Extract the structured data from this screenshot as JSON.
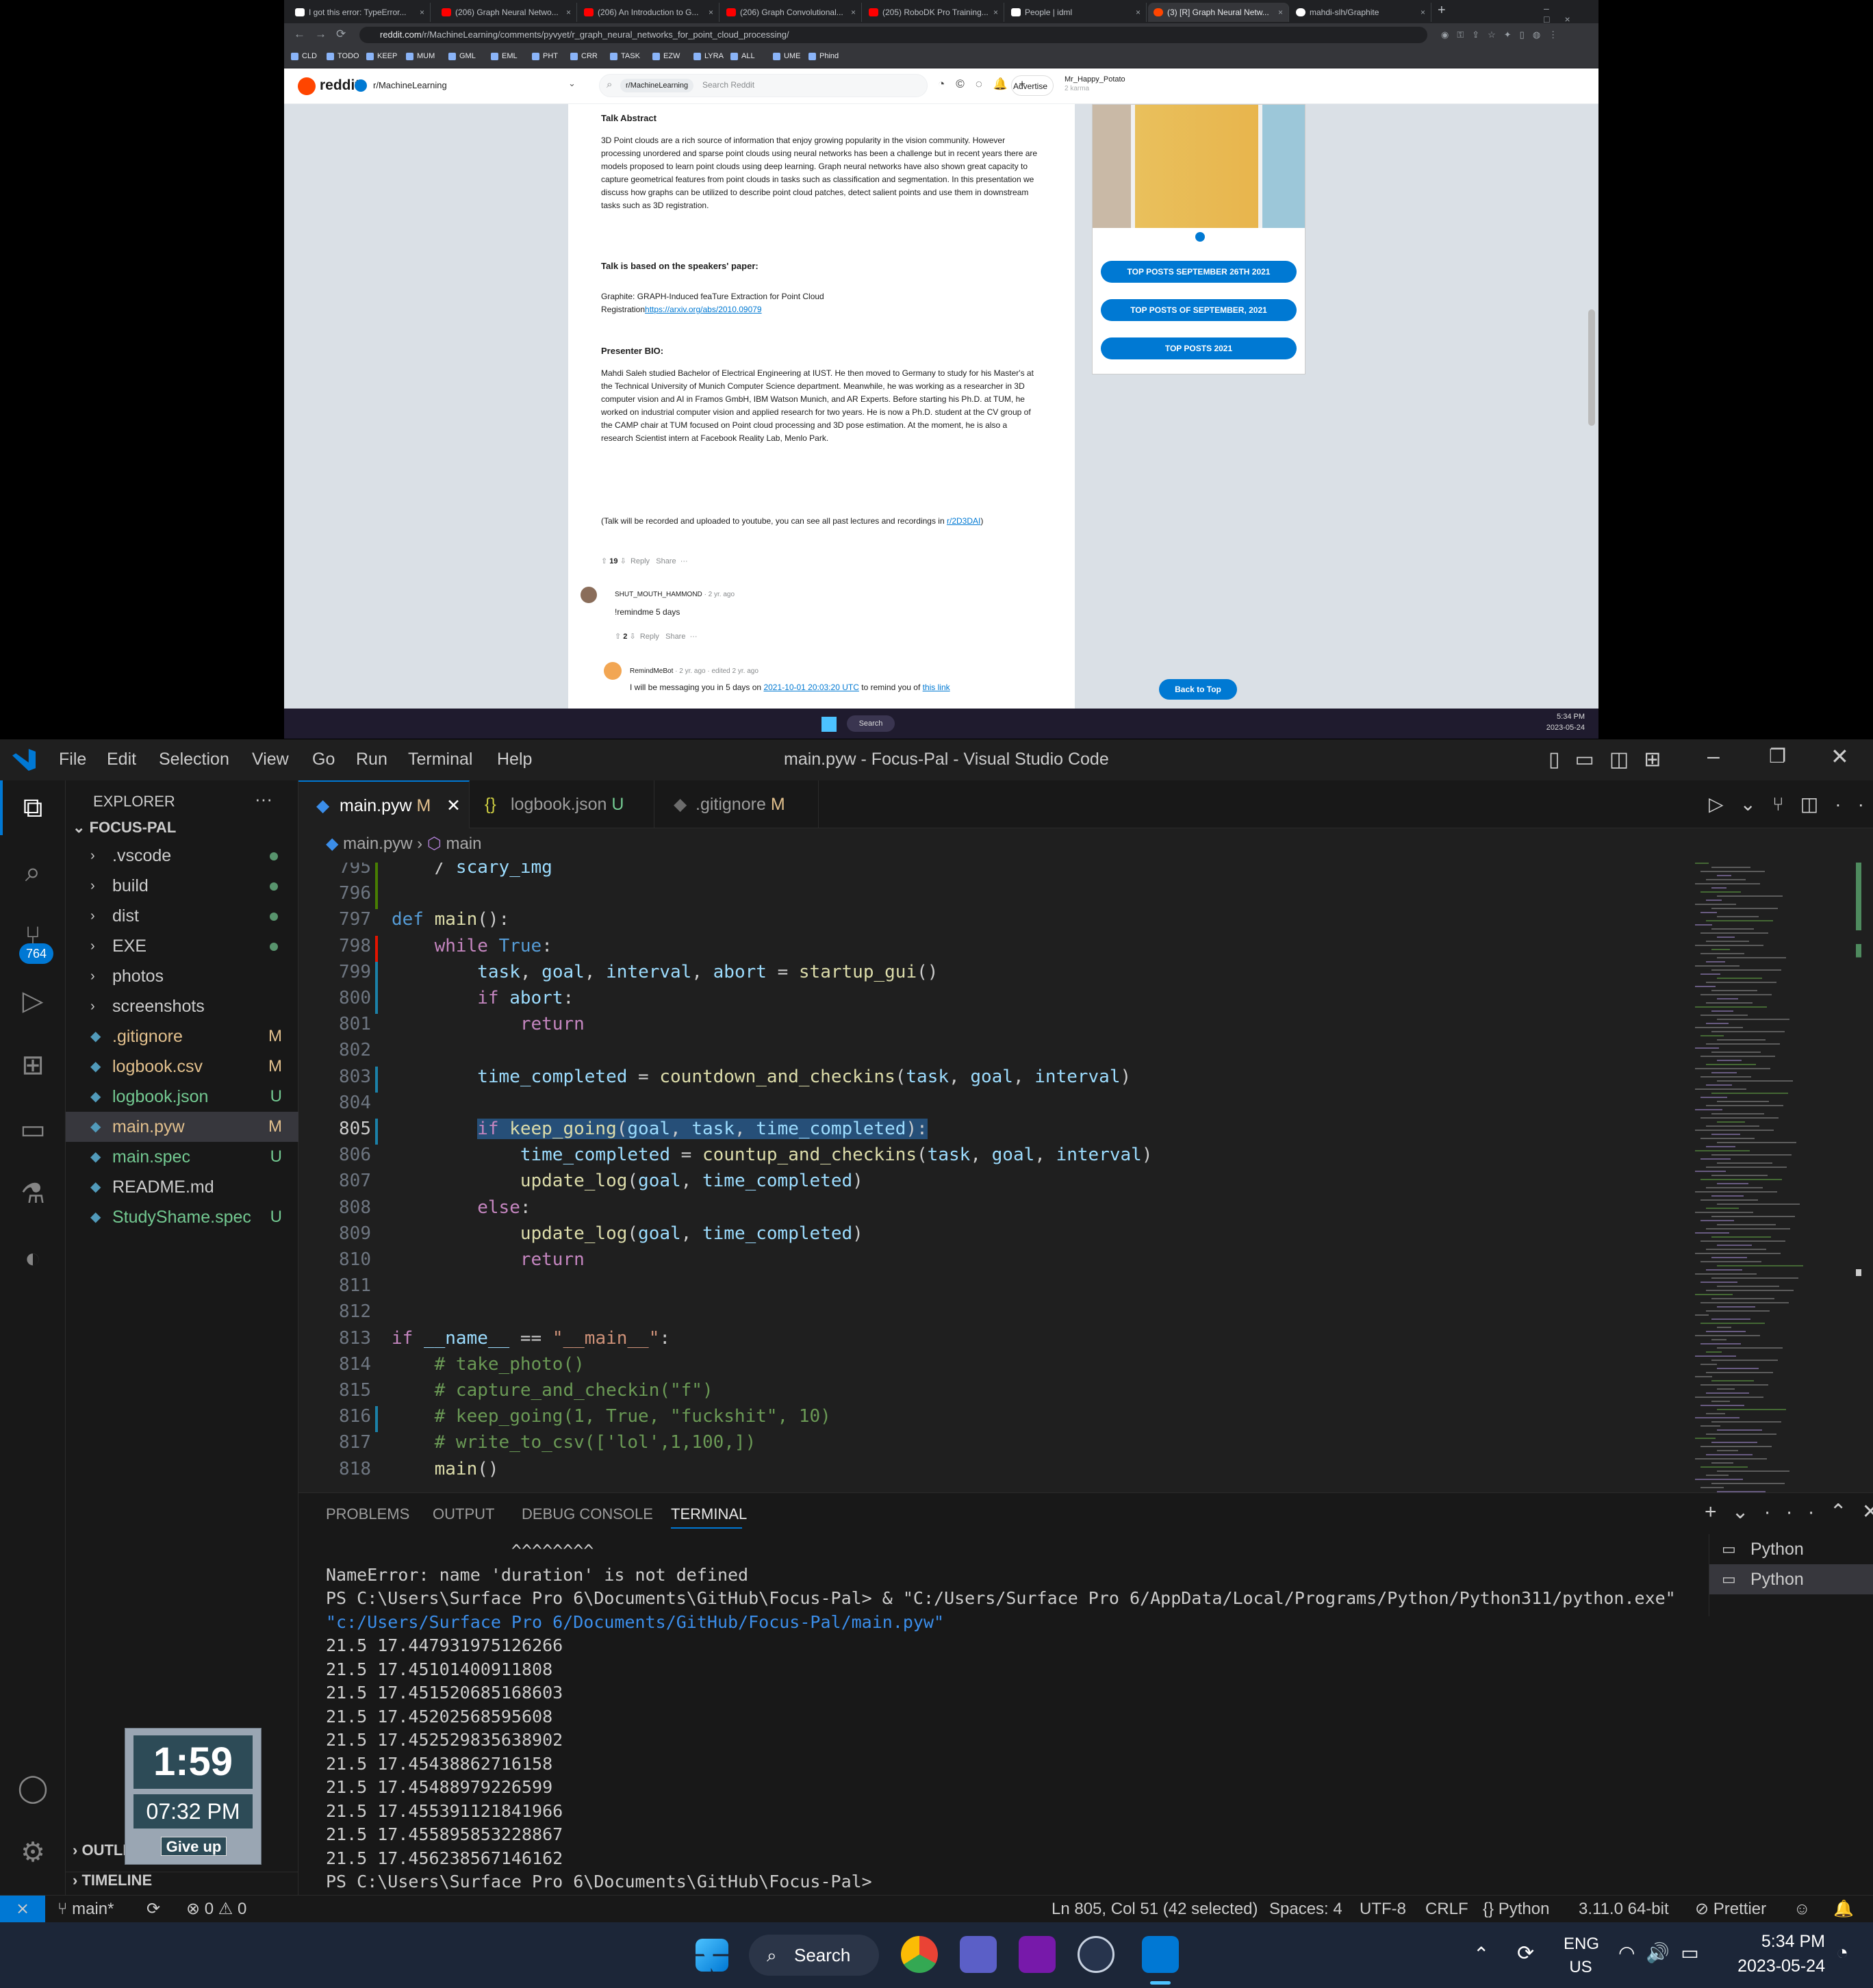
{
  "browser": {
    "tabs": [
      {
        "label": "I got this error: TypeError..."
      },
      {
        "label": "(206) Graph Neural Netwo..."
      },
      {
        "label": "(206) An Introduction to G..."
      },
      {
        "label": "(206) Graph Convolutional..."
      },
      {
        "label": "(205) RoboDK Pro Training..."
      },
      {
        "label": "People | idml"
      },
      {
        "label": "(3) [R] Graph Neural Netw..."
      },
      {
        "label": "mahdi-slh/Graphite"
      }
    ],
    "url_host": "reddit.com",
    "url_path": "/r/MachineLearning/comments/pyvyet/r_graph_neural_networks_for_point_cloud_processing/",
    "bookmarks": [
      "CLD",
      "TODO",
      "KEEP",
      "MUM",
      "GML",
      "EML",
      "PHT",
      "CRR",
      "TASK",
      "EZW",
      "LYRA",
      "ALL",
      "UME",
      "Phind"
    ]
  },
  "reddit": {
    "logo": "reddit",
    "subreddit": "r/MachineLearning",
    "search_chip": "r/MachineLearning",
    "search_placeholder": "Search Reddit",
    "advertise": "Advertise",
    "username": "Mr_Happy_Potato",
    "karma": "2 karma",
    "talk_abstract_h": "Talk Abstract",
    "talk_abstract": "3D Point clouds are a rich source of information that enjoy growing popularity in the vision community. However processing unordered and sparse point clouds using neural networks has been a challenge but in recent years there are models proposed to learn point clouds using deep learning. Graph neural networks have also shown great capacity to capture geometrical features from point clouds in tasks such as classification and segmentation. In this presentation we discuss how graphs can be utilized to describe point cloud patches, detect salient points and use them in downstream tasks such as 3D registration.",
    "paper_h": "Talk is based on the speakers' paper:",
    "paper_text": "Graphite: GRAPH-Induced feaTure Extraction for Point Cloud Registration",
    "paper_link": "https://arxiv.org/abs/2010.09079",
    "bio_h": "Presenter BIO:",
    "bio": "Mahdi Saleh studied Bachelor of Electrical Engineering at IUST. He then moved to Germany to study for his Master's at the Technical University of Munich Computer Science department. Meanwhile, he was working as a researcher in 3D computer vision and AI in Framos GmbH, IBM Watson Munich, and AR Experts. Before starting his Ph.D. at TUM, he worked on industrial computer vision and applied research for two years. He is now a Ph.D. student at the CV group of the CAMP chair at TUM focused on Point cloud processing and 3D pose estimation. At the moment, he is also a research Scientist intern at Facebook Reality Lab, Menlo Park.",
    "recorded": "(Talk will be recorded and uploaded to youtube, you can see all past lectures and recordings in",
    "recorded_link": "r/2D3DAI",
    "post_votes": "19",
    "reply": "Reply",
    "share": "Share",
    "c1_user": "SHUT_MOUTH_HAMMOND",
    "c1_age": "· 2 yr. ago",
    "c1_text": "!remindme 5 days",
    "c1_votes": "2",
    "c2_user": "RemindMeBot",
    "c2_age": "· 2 yr. ago · edited 2 yr. ago",
    "c2_text": "I will be messaging you in 5 days on",
    "c2_link": "2021-10-01 20:03:20 UTC",
    "c2_text2": "to remind you of",
    "c2_link2": "this link",
    "side_buttons": [
      "TOP POSTS SEPTEMBER 26TH 2021",
      "TOP POSTS OF SEPTEMBER, 2021",
      "TOP POSTS 2021"
    ],
    "back_to_top": "Back to Top",
    "top_clock_time": "5:34 PM",
    "top_clock_date": "2023-05-24",
    "top_search": "Search"
  },
  "vscode": {
    "menu": [
      "File",
      "Edit",
      "Selection",
      "View",
      "Go",
      "Run",
      "Terminal",
      "Help"
    ],
    "title": "main.pyw - Focus-Pal - Visual Studio Code",
    "scm_badge": "764",
    "explorer_title": "EXPLORER",
    "folder": "FOCUS-PAL",
    "tree": [
      {
        "name": ".vscode",
        "kind": "folder",
        "badge": ""
      },
      {
        "name": "build",
        "kind": "folder",
        "badge": ""
      },
      {
        "name": "dist",
        "kind": "folder",
        "badge": ""
      },
      {
        "name": "EXE",
        "kind": "folder",
        "badge": ""
      },
      {
        "name": "photos",
        "kind": "folder",
        "badge": ""
      },
      {
        "name": "screenshots",
        "kind": "folder",
        "badge": ""
      },
      {
        "name": ".gitignore",
        "kind": "file",
        "badge": "M"
      },
      {
        "name": "logbook.csv",
        "kind": "file",
        "badge": "M"
      },
      {
        "name": "logbook.json",
        "kind": "file",
        "badge": "U"
      },
      {
        "name": "main.pyw",
        "kind": "file",
        "badge": "M"
      },
      {
        "name": "main.spec",
        "kind": "file",
        "badge": "U"
      },
      {
        "name": "README.md",
        "kind": "file",
        "badge": ""
      },
      {
        "name": "StudyShame.spec",
        "kind": "file",
        "badge": "U"
      }
    ],
    "outline": "OUTLINE",
    "timeline": "TIMELINE",
    "tabs": [
      {
        "label": "main.pyw",
        "badge": "M"
      },
      {
        "label": "logbook.json",
        "badge": "U"
      },
      {
        "label": ".gitignore",
        "badge": "M"
      }
    ],
    "breadcrumb_file": "main.pyw",
    "breadcrumb_symbol": "main",
    "line_numbers": [
      "795",
      "796",
      "797",
      "798",
      "799",
      "800",
      "801",
      "802",
      "803",
      "804",
      "805",
      "806",
      "807",
      "808",
      "809",
      "810",
      "811",
      "812",
      "813",
      "814",
      "815",
      "816",
      "817",
      "818"
    ],
    "panel_tabs": [
      "PROBLEMS",
      "OUTPUT",
      "DEBUG CONSOLE",
      "TERMINAL"
    ],
    "terminal_lines": [
      "                  ^^^^^^^^",
      "NameError: name 'duration' is not defined",
      "PS C:\\Users\\Surface Pro 6\\Documents\\GitHub\\Focus-Pal> & \"C:/Users/Surface Pro 6/AppData/Local/Programs/Python/Python311/python.exe\"",
      "\"c:/Users/Surface Pro 6/Documents/GitHub/Focus-Pal/main.pyw\"",
      "21.5 17.447931975126266",
      "21.5 17.45101400911808",
      "21.5 17.451520685168603",
      "21.5 17.45202568595608",
      "21.5 17.452529835638902",
      "21.5 17.45438862716158",
      "21.5 17.45488979226599",
      "21.5 17.455391121841966",
      "21.5 17.455895853228867",
      "21.5 17.456238567146162",
      "PS C:\\Users\\Surface Pro 6\\Documents\\GitHub\\Focus-Pal>"
    ],
    "terminals": [
      "Python",
      "Python"
    ],
    "status": {
      "branch": "main*",
      "errors": "0",
      "warnings": "0",
      "cursor": "Ln 805, Col 51 (42 selected)",
      "spaces": "Spaces: 4",
      "encoding": "UTF-8",
      "eol": "CRLF",
      "language": "Python",
      "interpreter": "3.11.0 64-bit",
      "prettier": "Prettier"
    }
  },
  "timer": {
    "countdown": "1:59",
    "clock": "07:32 PM",
    "give_up": "Give up"
  },
  "taskbar": {
    "search": "Search",
    "lang1": "ENG",
    "lang2": "US",
    "time": "5:34 PM",
    "date": "2023-05-24"
  },
  "colors": {
    "vscode_accent": "#0078d4",
    "reddit_blue": "#0079d3",
    "reddit_orange": "#ff4500"
  }
}
